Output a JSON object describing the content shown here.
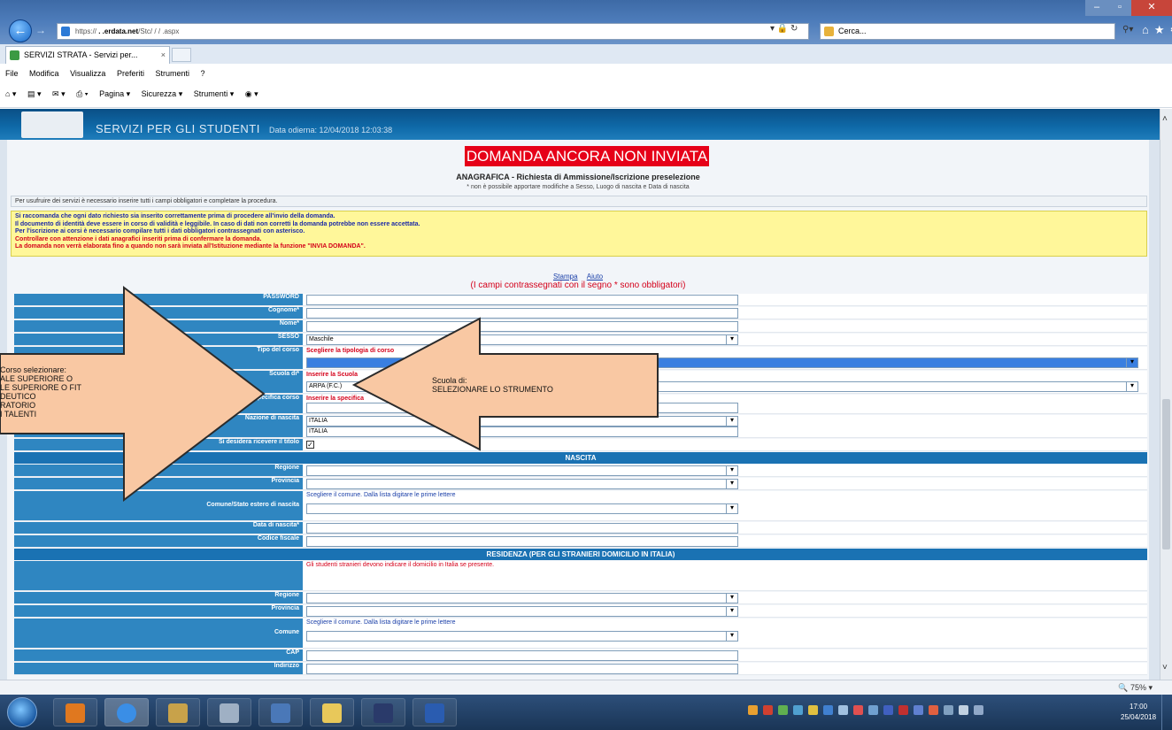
{
  "browser": {
    "url_prefix": "https://",
    "url_host": "              .    .erdata.net",
    "url_path": "/Stc/      /      /            .aspx",
    "search_placeholder": "Cerca...",
    "tab_title": "SERVIZI STRATA - Servizi per...",
    "menu": [
      "File",
      "Modifica",
      "Visualizza",
      "Preferiti",
      "Strumenti",
      "?"
    ],
    "commands": [
      "Pagina ▾",
      "Sicurezza ▾",
      "Strumenti ▾"
    ],
    "zoom": "75%"
  },
  "header": {
    "title": "SERVIZI PER GLI STUDENTI",
    "date_label": "Data odierna: 12/04/2018 12:03:38",
    "signature": "                "
  },
  "page": {
    "status_banner": "DOMANDA ANCORA NON INVIATA",
    "subtitle": "ANAGRAFICA - Richiesta di Ammissione/Iscrizione preselezione",
    "subnote": "* non è possibile apportare modifiche a Sesso, Luogo di nascita e Data di nascita",
    "info_bar": "Per usufruire dei servizi è necessario inserire tutti i campi obbligatori e completare la procedura.",
    "warning_lines": [
      "Si raccomanda che ogni dato richiesto sia inserito correttamente prima di procedere all'invio della domanda.",
      "Il documento di identità deve essere in corso di validità e leggibile. In caso di dati non corretti la domanda potrebbe non essere accettata.",
      "Per l'iscrizione ai corsi è necessario compilare tutti i dati obbligatori contrassegnati con asterisco.",
      "Controllare con attenzione i dati anagrafici inseriti prima di confermare la domanda.",
      "La domanda non verrà elaborata fino a quando non sarà inviata all'Istituzione mediante la funzione \"INVIA DOMANDA\"."
    ],
    "link_print": "Stampa",
    "link_help": "Aiuto",
    "required_note": "(I campi contrassegnati con il segno * sono obbligatori)"
  },
  "form": {
    "rows": [
      {
        "label": "PASSWORD",
        "value": "          ",
        "kind": "input",
        "input_width": 488
      },
      {
        "label": "Cognome*",
        "value": "",
        "kind": "input",
        "input_width": 488
      },
      {
        "label": "Nome*",
        "value": "",
        "kind": "input",
        "input_width": 488
      },
      {
        "label": "SESSO",
        "value": "Maschile",
        "kind": "select",
        "input_width": 488
      },
      {
        "label": "Tipo del corso",
        "value": "",
        "kind": "select",
        "input_width": 960,
        "note": "Scegliere la tipologia di corso"
      },
      {
        "label": "Scuola di*",
        "value": "ARPA (F.C.)",
        "kind": "select",
        "input_width": 960,
        "note": "Inserire la Scuola"
      },
      {
        "label": "Specifica corso",
        "value": "",
        "kind": "input",
        "input_width": 488,
        "note": "Inserire la specifica"
      },
      {
        "label": "Nazione di nascita",
        "value": "ITALIA",
        "kind": "select",
        "input_width": 488
      },
      {
        "label": "",
        "value": "ITALIA",
        "kind": "input",
        "input_width": 488
      },
      {
        "label": "Si desidera ricevere il titolo",
        "value": "",
        "kind": "check"
      }
    ],
    "section_nascita": "NASCITA",
    "nascita_rows": [
      {
        "label": "Regione",
        "value": "",
        "kind": "select"
      },
      {
        "label": "Provincia",
        "value": "",
        "kind": "select"
      },
      {
        "label": "Comune/Stato estero di nascita",
        "value": "",
        "kind": "select",
        "note": "Scegliere il comune. Dalla lista digitare le prime lettere"
      },
      {
        "label": "Data di nascita*",
        "value": "",
        "kind": "input"
      },
      {
        "label": "Codice fiscale",
        "value": "",
        "kind": "input"
      }
    ],
    "section_residenza": "RESIDENZA (PER GLI STRANIERI DOMICILIO IN ITALIA)",
    "residenza_note": "Gli studenti stranieri devono indicare il domicilio in Italia se presente.",
    "residenza_rows": [
      {
        "label": "Regione",
        "value": "",
        "kind": "select"
      },
      {
        "label": "Provincia",
        "value": "",
        "kind": "select"
      },
      {
        "label": "Comune",
        "value": "",
        "kind": "select",
        "note": "Scegliere il comune. Dalla lista digitare le prime lettere"
      },
      {
        "label": "CAP",
        "value": "",
        "kind": "input"
      },
      {
        "label": "Indirizzo",
        "value": "",
        "kind": "input"
      }
    ]
  },
  "annotations": {
    "left_callout": [
      "Corso selezionare:",
      "ALE SUPERIORE O",
      "LE SUPERIORE  O FIT",
      "DEUTICO",
      "RATORIO",
      "I TALENTI"
    ],
    "center_callout": [
      "Scuola di:",
      "SELEZIONARE LO STRUMENTO"
    ],
    "fill_color": "#f9c8a3",
    "stroke_color": "#2b2b2b"
  },
  "taskbar": {
    "clock_time": "17:00",
    "clock_date": "25/04/2018"
  }
}
